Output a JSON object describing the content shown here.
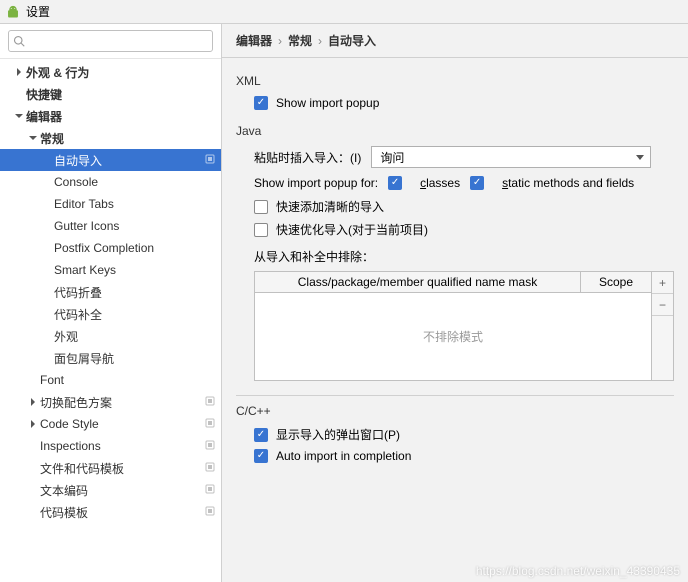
{
  "window": {
    "title": "设置"
  },
  "search": {
    "placeholder": ""
  },
  "tree": {
    "items": [
      {
        "label": "外观 & 行为",
        "depth": 1,
        "arrow": "right",
        "bold": true
      },
      {
        "label": "快捷键",
        "depth": 1,
        "bold": true
      },
      {
        "label": "编辑器",
        "depth": 1,
        "arrow": "down",
        "bold": true
      },
      {
        "label": "常规",
        "depth": 2,
        "arrow": "down",
        "bold": true
      },
      {
        "label": "自动导入",
        "depth": 3,
        "selected": true,
        "badge": true
      },
      {
        "label": "Console",
        "depth": 3
      },
      {
        "label": "Editor Tabs",
        "depth": 3
      },
      {
        "label": "Gutter Icons",
        "depth": 3
      },
      {
        "label": "Postfix Completion",
        "depth": 3
      },
      {
        "label": "Smart Keys",
        "depth": 3
      },
      {
        "label": "代码折叠",
        "depth": 3
      },
      {
        "label": "代码补全",
        "depth": 3
      },
      {
        "label": "外观",
        "depth": 3
      },
      {
        "label": "面包屑导航",
        "depth": 3
      },
      {
        "label": "Font",
        "depth": 2
      },
      {
        "label": "切换配色方案",
        "depth": 2,
        "arrow": "right",
        "badge": true
      },
      {
        "label": "Code Style",
        "depth": 2,
        "arrow": "right",
        "badge": true
      },
      {
        "label": "Inspections",
        "depth": 2,
        "badge": true
      },
      {
        "label": "文件和代码模板",
        "depth": 2,
        "badge": true
      },
      {
        "label": "文本编码",
        "depth": 2,
        "badge": true
      },
      {
        "label": "代码模板",
        "depth": 2,
        "badge": true
      }
    ]
  },
  "breadcrumb": [
    "编辑器",
    "常规",
    "自动导入"
  ],
  "xml": {
    "section": "XML",
    "show_popup_label": "Show import popup",
    "show_popup_checked": true
  },
  "java": {
    "section": "Java",
    "paste_label": "粘贴时插入导入：(I)",
    "paste_select_value": "询问",
    "popup_for_label": "Show import popup for:",
    "classes_label": "classes",
    "classes_checked": true,
    "static_label": "static methods and fields",
    "static_checked": true,
    "add_unambiguous_label": "快速添加清晰的导入",
    "add_unambiguous_checked": false,
    "optimize_label": "快速优化导入(对于当前项目)",
    "optimize_checked": false,
    "exclude_label": "从导入和补全中排除：",
    "table_col1": "Class/package/member qualified name mask",
    "table_col2": "Scope",
    "table_empty": "不排除模式",
    "add_btn": "+",
    "remove_btn": "−"
  },
  "ccpp": {
    "section": "C/C++",
    "show_popup_label": "显示导入的弹出窗口(P)",
    "show_popup_checked": true,
    "auto_import_label": "Auto import in completion",
    "auto_import_checked": true
  },
  "watermark": "https://blog.csdn.net/weixin_43390435"
}
